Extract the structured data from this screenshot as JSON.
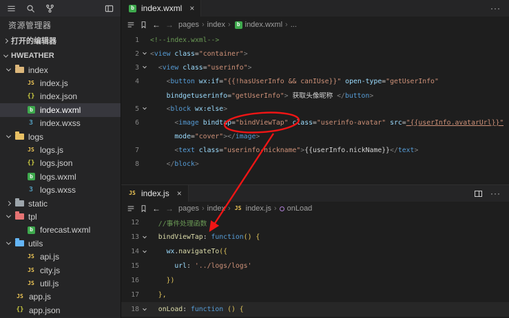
{
  "icons": {
    "more": "···",
    "back": "←",
    "forward": "→",
    "close": "×",
    "js_glyph": "JS",
    "json_glyph": "{}",
    "wxml_glyph": "b",
    "wxss_glyph": "3"
  },
  "colors": {
    "annotation_red": "#f01515",
    "tag_blue": "#569cd6",
    "attr_lightblue": "#9cdcfe",
    "string_orange": "#ce9178",
    "comment_green": "#6a9955",
    "function_yellow": "#dcdcaa",
    "wxml_icon_green": "#3ea94d",
    "js_icon_yellow": "#efc756",
    "wxss_icon_blue": "#519aba"
  },
  "sidebar": {
    "title": "资源管理器",
    "open_editors_label": "打开的编辑器",
    "project_label": "HWEATHER",
    "tree": [
      {
        "name": "index",
        "type": "folder",
        "state": "expanded",
        "depth": 1,
        "color": "#dcb67a"
      },
      {
        "name": "index.js",
        "type": "js",
        "depth": 2
      },
      {
        "name": "index.json",
        "type": "json",
        "depth": 2
      },
      {
        "name": "index.wxml",
        "type": "wxml",
        "depth": 2,
        "selected": true
      },
      {
        "name": "index.wxss",
        "type": "wxss",
        "depth": 2
      },
      {
        "name": "logs",
        "type": "folder",
        "state": "expanded",
        "depth": 1,
        "color": "#e8c064"
      },
      {
        "name": "logs.js",
        "type": "js",
        "depth": 2
      },
      {
        "name": "logs.json",
        "type": "json",
        "depth": 2
      },
      {
        "name": "logs.wxml",
        "type": "wxml",
        "depth": 2
      },
      {
        "name": "logs.wxss",
        "type": "wxss",
        "depth": 2
      },
      {
        "name": "static",
        "type": "folder",
        "state": "collapsed",
        "depth": 1,
        "color": "#9da5ab"
      },
      {
        "name": "tpl",
        "type": "folder",
        "state": "expanded",
        "depth": 1,
        "color": "#e57373"
      },
      {
        "name": "forecast.wxml",
        "type": "wxml",
        "depth": 2
      },
      {
        "name": "utils",
        "type": "folder",
        "state": "expanded",
        "depth": 1,
        "color": "#64b5f6"
      },
      {
        "name": "api.js",
        "type": "js",
        "depth": 2
      },
      {
        "name": "city.js",
        "type": "js",
        "depth": 2
      },
      {
        "name": "util.js",
        "type": "js",
        "depth": 2
      },
      {
        "name": "app.js",
        "type": "js",
        "depth": 1
      },
      {
        "name": "app.json",
        "type": "json",
        "depth": 1
      }
    ]
  },
  "editor_top": {
    "tab_label": "index.wxml",
    "breadcrumb": [
      {
        "label": "pages"
      },
      {
        "label": "index"
      },
      {
        "label": "index.wxml",
        "icon": "wxml"
      },
      {
        "label": "..."
      }
    ],
    "lines": [
      {
        "n": "1",
        "t": [
          [
            "cm",
            "<!--index.wxml-->"
          ]
        ]
      },
      {
        "n": "2",
        "fold": true,
        "t": [
          [
            "br",
            "<"
          ],
          [
            "tag",
            "view"
          ],
          [
            "tx",
            " "
          ],
          [
            "attr",
            "class"
          ],
          [
            "tx",
            "="
          ],
          [
            "str",
            "\"container\""
          ],
          [
            "br",
            ">"
          ]
        ]
      },
      {
        "n": "3",
        "fold": true,
        "t": [
          [
            "tx",
            "  "
          ],
          [
            "br",
            "<"
          ],
          [
            "tag",
            "view"
          ],
          [
            "tx",
            " "
          ],
          [
            "attr",
            "class"
          ],
          [
            "tx",
            "="
          ],
          [
            "str",
            "\"userinfo\""
          ],
          [
            "br",
            ">"
          ]
        ]
      },
      {
        "n": "4",
        "t": [
          [
            "tx",
            "    "
          ],
          [
            "br",
            "<"
          ],
          [
            "tag",
            "button"
          ],
          [
            "tx",
            " "
          ],
          [
            "attr",
            "wx:if"
          ],
          [
            "tx",
            "="
          ],
          [
            "str",
            "\"{{!hasUserInfo && canIUse}}\""
          ],
          [
            "tx",
            " "
          ],
          [
            "attr",
            "open-type"
          ],
          [
            "tx",
            "="
          ],
          [
            "str",
            "\"getUserInfo\""
          ]
        ]
      },
      {
        "n": "",
        "t": [
          [
            "tx",
            "    "
          ],
          [
            "attr",
            "bindgetuserinfo"
          ],
          [
            "tx",
            "="
          ],
          [
            "str",
            "\"getUserInfo\""
          ],
          [
            "br",
            ">"
          ],
          [
            "tx",
            " 获取头像昵称 "
          ],
          [
            "br",
            "</"
          ],
          [
            "tag",
            "button"
          ],
          [
            "br",
            ">"
          ]
        ]
      },
      {
        "n": "5",
        "fold": true,
        "t": [
          [
            "tx",
            "    "
          ],
          [
            "br",
            "<"
          ],
          [
            "tag",
            "block"
          ],
          [
            "tx",
            " "
          ],
          [
            "attr",
            "wx:else"
          ],
          [
            "br",
            ">"
          ]
        ]
      },
      {
        "n": "6",
        "t": [
          [
            "tx",
            "      "
          ],
          [
            "br",
            "<"
          ],
          [
            "tag",
            "image"
          ],
          [
            "tx",
            " "
          ],
          [
            "attr",
            "bindtap"
          ],
          [
            "tx",
            "="
          ],
          [
            "str",
            "\"bindViewTap\""
          ],
          [
            "tx",
            " "
          ],
          [
            "attr",
            "class"
          ],
          [
            "tx",
            "="
          ],
          [
            "str",
            "\"userinfo-avatar\""
          ],
          [
            "tx",
            " "
          ],
          [
            "attr",
            "src"
          ],
          [
            "tx",
            "="
          ],
          [
            "strU",
            "\"{{userInfo.avatarUrl}}\""
          ]
        ]
      },
      {
        "n": "",
        "t": [
          [
            "tx",
            "      "
          ],
          [
            "attr",
            "mode"
          ],
          [
            "tx",
            "="
          ],
          [
            "str",
            "\"cover\""
          ],
          [
            "br",
            "></"
          ],
          [
            "tag",
            "image"
          ],
          [
            "br",
            ">"
          ]
        ]
      },
      {
        "n": "7",
        "t": [
          [
            "tx",
            "      "
          ],
          [
            "br",
            "<"
          ],
          [
            "tag",
            "text"
          ],
          [
            "tx",
            " "
          ],
          [
            "attr",
            "class"
          ],
          [
            "tx",
            "="
          ],
          [
            "str",
            "\"userinfo-nickname\""
          ],
          [
            "br",
            ">"
          ],
          [
            "tx",
            "{{userInfo.nickName}}"
          ],
          [
            "br",
            "</"
          ],
          [
            "tag",
            "text"
          ],
          [
            "br",
            ">"
          ]
        ]
      },
      {
        "n": "8",
        "t": [
          [
            "tx",
            "    "
          ],
          [
            "br",
            "</"
          ],
          [
            "tag",
            "block"
          ],
          [
            "br",
            ">"
          ]
        ]
      }
    ]
  },
  "editor_bottom": {
    "tab_label": "index.js",
    "breadcrumb": [
      {
        "label": "pages"
      },
      {
        "label": "index"
      },
      {
        "label": "index.js",
        "icon": "js"
      },
      {
        "label": "onLoad",
        "icon": "method"
      }
    ],
    "lines": [
      {
        "n": "12",
        "t": [
          [
            "tx",
            "  "
          ],
          [
            "cm",
            "//事件处理函数"
          ]
        ]
      },
      {
        "n": "13",
        "fold": true,
        "t": [
          [
            "tx",
            "  "
          ],
          [
            "fn",
            "bindViewTap"
          ],
          [
            "tx",
            ": "
          ],
          [
            "kw",
            "function"
          ],
          [
            "bk",
            "()"
          ],
          [
            "tx",
            " "
          ],
          [
            "bk",
            "{"
          ]
        ]
      },
      {
        "n": "14",
        "fold": true,
        "t": [
          [
            "tx",
            "    "
          ],
          [
            "vr",
            "wx"
          ],
          [
            "tx",
            "."
          ],
          [
            "fn",
            "navigateTo"
          ],
          [
            "bk",
            "({"
          ]
        ]
      },
      {
        "n": "15",
        "t": [
          [
            "tx",
            "      "
          ],
          [
            "vr",
            "url"
          ],
          [
            "tx",
            ": "
          ],
          [
            "str",
            "'../logs/logs'"
          ]
        ]
      },
      {
        "n": "16",
        "t": [
          [
            "tx",
            "    "
          ],
          [
            "bk",
            "})"
          ]
        ]
      },
      {
        "n": "17",
        "t": [
          [
            "tx",
            "  "
          ],
          [
            "bk",
            "},"
          ]
        ]
      },
      {
        "n": "18",
        "fold": true,
        "hl": true,
        "t": [
          [
            "tx",
            "  "
          ],
          [
            "fn",
            "onLoad"
          ],
          [
            "tx",
            ": "
          ],
          [
            "kw",
            "function"
          ],
          [
            "tx",
            " "
          ],
          [
            "bk",
            "()"
          ],
          [
            "tx",
            " "
          ],
          [
            "bk",
            "{"
          ]
        ]
      }
    ]
  },
  "annotation": {
    "circled_text": "bindViewTap",
    "color": "#f01515"
  }
}
